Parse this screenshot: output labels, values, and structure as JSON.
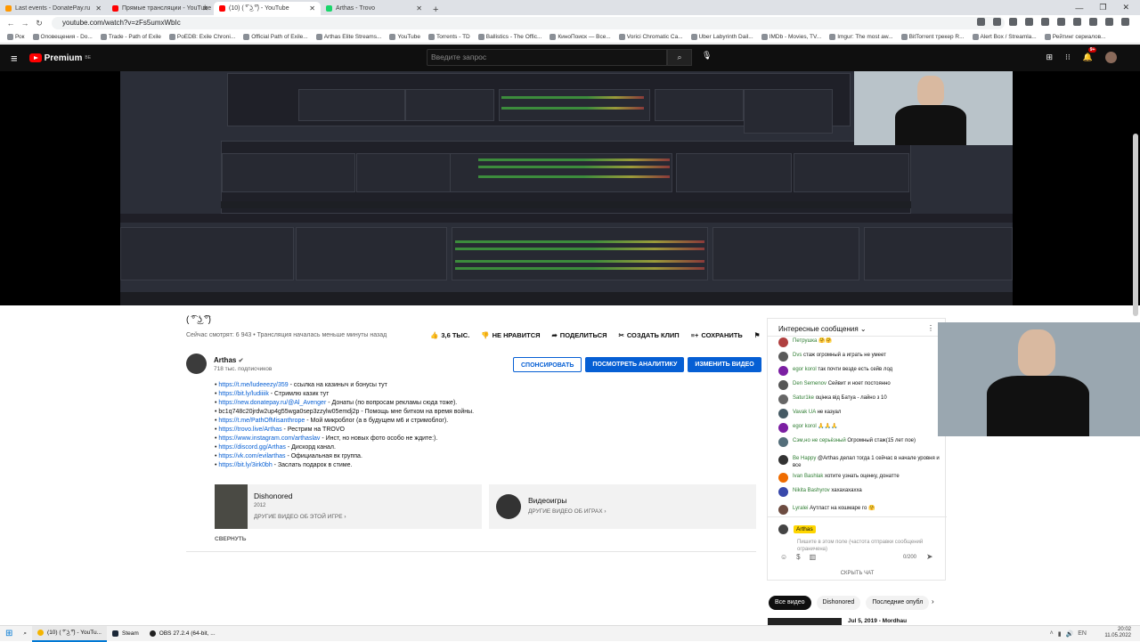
{
  "browser": {
    "tabs": [
      {
        "label": "Last events - DonatePay.ru",
        "color": "#ff9800"
      },
      {
        "label": "Прямые трансляции - YouTube",
        "color": "#ff0000"
      },
      {
        "label": "(10) ( ͡° ͜ʖ ͡°) - YouTube",
        "color": "#ff0000"
      },
      {
        "label": "Arthas - Trovo",
        "color": "#19d66b"
      }
    ],
    "new_tab": "+",
    "url": "youtube.com/watch?v=zFs5umxWbIc",
    "bookmarks": [
      "Рок",
      "Оповещения - Do...",
      "Trade - Path of Exile",
      "PoEDB: Exile Chroni...",
      "Official Path of Exile...",
      "Arthas Elite Streams...",
      "YouTube",
      "Torrents - TD",
      "Ballistics - The Offic...",
      "КиноПоиск — Все...",
      "Vorici Chromatic Ca...",
      "Uber Labyrinth Dail...",
      "IMDb - Movies, TV...",
      "Imgur: The most aw...",
      "BitTorrent трекер R...",
      "Alert Box / Streamla...",
      "Рейтинг сериалов..."
    ]
  },
  "youtube": {
    "logo": "Premium",
    "logo_region": "BE",
    "search_placeholder": "Введите запрос",
    "notif_count": "9+"
  },
  "video": {
    "title": "( ͡° ͜ʖ ͡°)",
    "meta": "Сейчас смотрят: 6 943 • Трансляция началась меньше минуты назад",
    "likes": "3,6 ТЫС.",
    "dislike": "НЕ НРАВИТСЯ",
    "share": "ПОДЕЛИТЬСЯ",
    "clip": "СОЗДАТЬ КЛИП",
    "save": "СОХРАНИТЬ"
  },
  "channel": {
    "name": "Arthas",
    "subs": "718 тыс. подписчиков",
    "sponsor": "СПОНСИРОВАТЬ",
    "analytics": "ПОСМОТРЕТЬ АНАЛИТИКУ",
    "edit": "ИЗМЕНИТЬ ВИДЕО"
  },
  "description": [
    {
      "link": "https://t.me/ludeeezy/359",
      "text": " - ссылка на казиныч и бонусы тут"
    },
    {
      "link": "https://bit.ly/ludiiiik",
      "text": " - Стримлю казик тут"
    },
    {
      "link": "https://new.donatepay.ru/@Al_Avenger",
      "text": " - Донаты (по вопросам рекламы сюда тоже)."
    },
    {
      "link": "",
      "text": "bc1q748c20jrdw2up4g55wga0sep3zzylw05emdj2p - Помощь мне битком на время войны."
    },
    {
      "link": "https://t.me/PathOfMisanthrope",
      "text": " - Мой микроблог (а в будущем м6 и стримоблог)."
    },
    {
      "link": "https://trovo.live/Arthas",
      "text": " - Рестрим на TROVO"
    },
    {
      "link": "https://www.instagram.com/arthaslav",
      "text": " - Инст, но новых фото особо не ждите:)."
    },
    {
      "link": "https://discord.gg/Arthas",
      "text": " - Дискорд канал."
    },
    {
      "link": "https://vk.com/evilarthas",
      "text": " - Официальная вк группа."
    },
    {
      "link": "https://bit.ly/3irk0bh",
      "text": " - Заслать подарок в стиме."
    }
  ],
  "game": {
    "name": "Dishonored",
    "year": "2012",
    "link": "ДРУГИЕ ВИДЕО ОБ ЭТОЙ ИГРЕ"
  },
  "topic": {
    "name": "Видеоигры",
    "link": "ДРУГИЕ ВИДЕО ОБ ИГРАХ"
  },
  "collapse": "СВЕРНУТЬ",
  "chat": {
    "header": "Интересные сообщения",
    "messages": [
      {
        "name": "Петрушка",
        "text": "🤗🤗",
        "color": "#b04040"
      },
      {
        "name": "Dvs",
        "text": "стаж огромный а играть не умеет",
        "color": "#5a5a5a"
      },
      {
        "name": "egor korol",
        "text": "так почти везде есть сейв лод",
        "color": "#7b1fa2"
      },
      {
        "name": "Den Semenov",
        "text": "Сейвит и ноет постоянно",
        "color": "#555"
      },
      {
        "name": "Satur1ke",
        "text": "оцінка від Батуа - лайно з 10",
        "color": "#666"
      },
      {
        "name": "Vavak UA",
        "text": "не казуал",
        "color": "#455a64"
      },
      {
        "name": "egor korol",
        "text": "🙏🙏🙏",
        "color": "#7b1fa2"
      },
      {
        "name": "Сэм,но не серьёзный",
        "text": "Огромный стаж(15 лет пое)",
        "color": "#546e7a"
      },
      {
        "name": "Be Happy",
        "text": "@Arthas делал тогда 1 сейчас в начале уровня и все",
        "color": "#333"
      },
      {
        "name": "Ivan Bashlak",
        "text": "хотите узнать оценку, донатте",
        "color": "#ef6c00"
      },
      {
        "name": "Nikita Bashyrov",
        "text": "хахахахахха",
        "color": "#3949ab"
      },
      {
        "name": "Lyralei",
        "text": "Аутласт на кошмаре го 🤗",
        "color": "#6d4c41"
      }
    ],
    "me": "Arthas",
    "placeholder": "Пишите в этом поле (частота отправки сообщений ограничена)",
    "counter": "0/200",
    "hide": "СКРЫТЬ ЧАТ"
  },
  "related": {
    "chips": [
      "Все видео",
      "Dishonored",
      "Последние опубл"
    ],
    "first_title": "Jul 5, 2019 - Mordhau"
  },
  "taskbar": {
    "items": [
      "(10) ( ͡° ͜ʖ ͡°) - YouTu...",
      "Steam",
      "OBS 27.2.4 (64-bit, ..."
    ],
    "time": "20:02",
    "date": "11.05.2022"
  }
}
